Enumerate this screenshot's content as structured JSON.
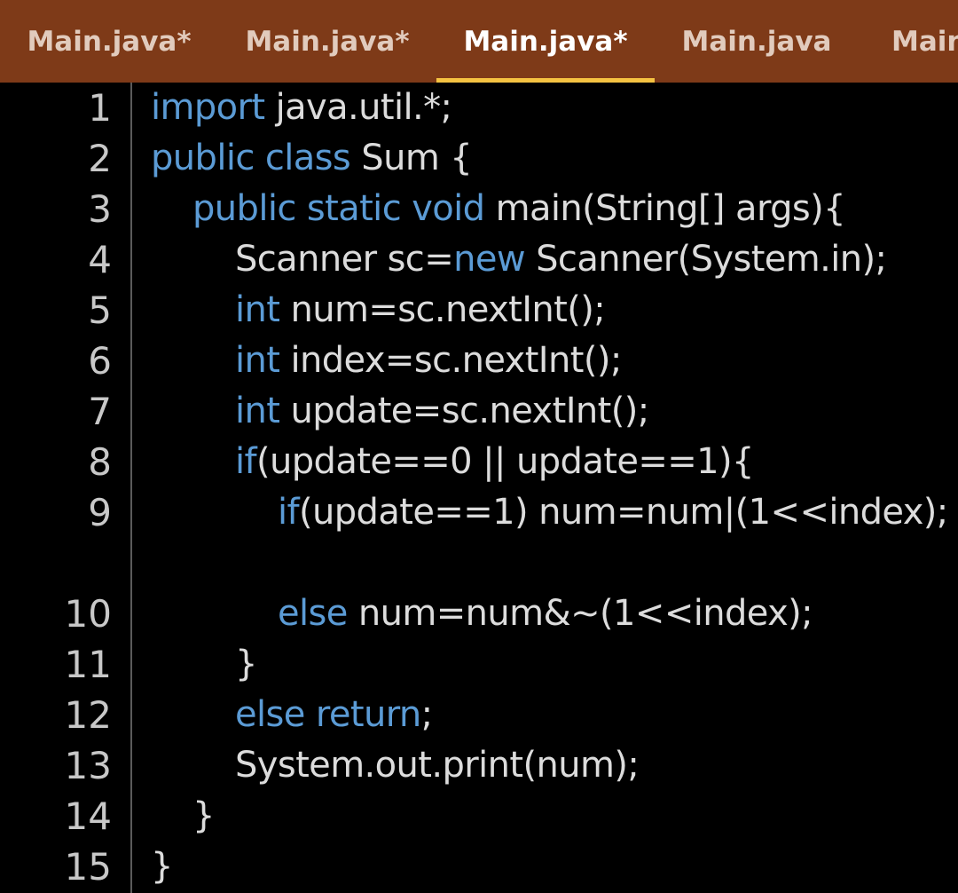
{
  "tabs": [
    {
      "label": "Main.java*"
    },
    {
      "label": "Main.java*"
    },
    {
      "label": "Main.java*",
      "active": true
    },
    {
      "label": "Main.java"
    },
    {
      "label": "Main"
    }
  ],
  "colors": {
    "tabbar": "#7e3a18",
    "active_underline": "#f5c242",
    "keyword": "#5b9bd5",
    "text": "#dcdcdc",
    "background": "#000000"
  },
  "code": {
    "lines": [
      {
        "n": "1",
        "tokens": [
          [
            "kw",
            "import"
          ],
          [
            "t",
            " java.util.*;"
          ]
        ]
      },
      {
        "n": "2",
        "tokens": [
          [
            "kw",
            "public class"
          ],
          [
            "t",
            " Sum {"
          ]
        ]
      },
      {
        "n": "3",
        "tokens": [
          [
            "kw",
            "public static void"
          ],
          [
            "t",
            " main(String[] args){"
          ]
        ]
      },
      {
        "n": "4",
        "tokens": [
          [
            "t",
            "Scanner sc="
          ],
          [
            "kw",
            "new"
          ],
          [
            "t",
            " Scanner(System.in);"
          ]
        ]
      },
      {
        "n": "5",
        "tokens": [
          [
            "kw",
            "int"
          ],
          [
            "t",
            " num=sc.nextInt();"
          ]
        ]
      },
      {
        "n": "6",
        "tokens": [
          [
            "kw",
            "int"
          ],
          [
            "t",
            " index=sc.nextInt();"
          ]
        ]
      },
      {
        "n": "7",
        "tokens": [
          [
            "kw",
            "int"
          ],
          [
            "t",
            " update=sc.nextInt();"
          ]
        ]
      },
      {
        "n": "8",
        "tokens": [
          [
            "kw",
            "if"
          ],
          [
            "t",
            "(update==0 || update==1){"
          ]
        ]
      },
      {
        "n": "9",
        "tokens": [
          [
            "kw",
            "if"
          ],
          [
            "t",
            "(update==1) num=num|(1<<index);"
          ]
        ]
      },
      {
        "n": "10",
        "tokens": [
          [
            "kw",
            "else"
          ],
          [
            "t",
            " num=num&~(1<<index);"
          ]
        ]
      },
      {
        "n": "11",
        "tokens": [
          [
            "t",
            "}"
          ]
        ]
      },
      {
        "n": "12",
        "tokens": [
          [
            "kw",
            "else return"
          ],
          [
            "t",
            ";"
          ]
        ]
      },
      {
        "n": "13",
        "tokens": [
          [
            "t",
            "System.out.print(num);"
          ]
        ]
      },
      {
        "n": "14",
        "tokens": [
          [
            "t",
            "}"
          ]
        ]
      },
      {
        "n": "15",
        "tokens": [
          [
            "t",
            "}"
          ]
        ]
      }
    ]
  }
}
